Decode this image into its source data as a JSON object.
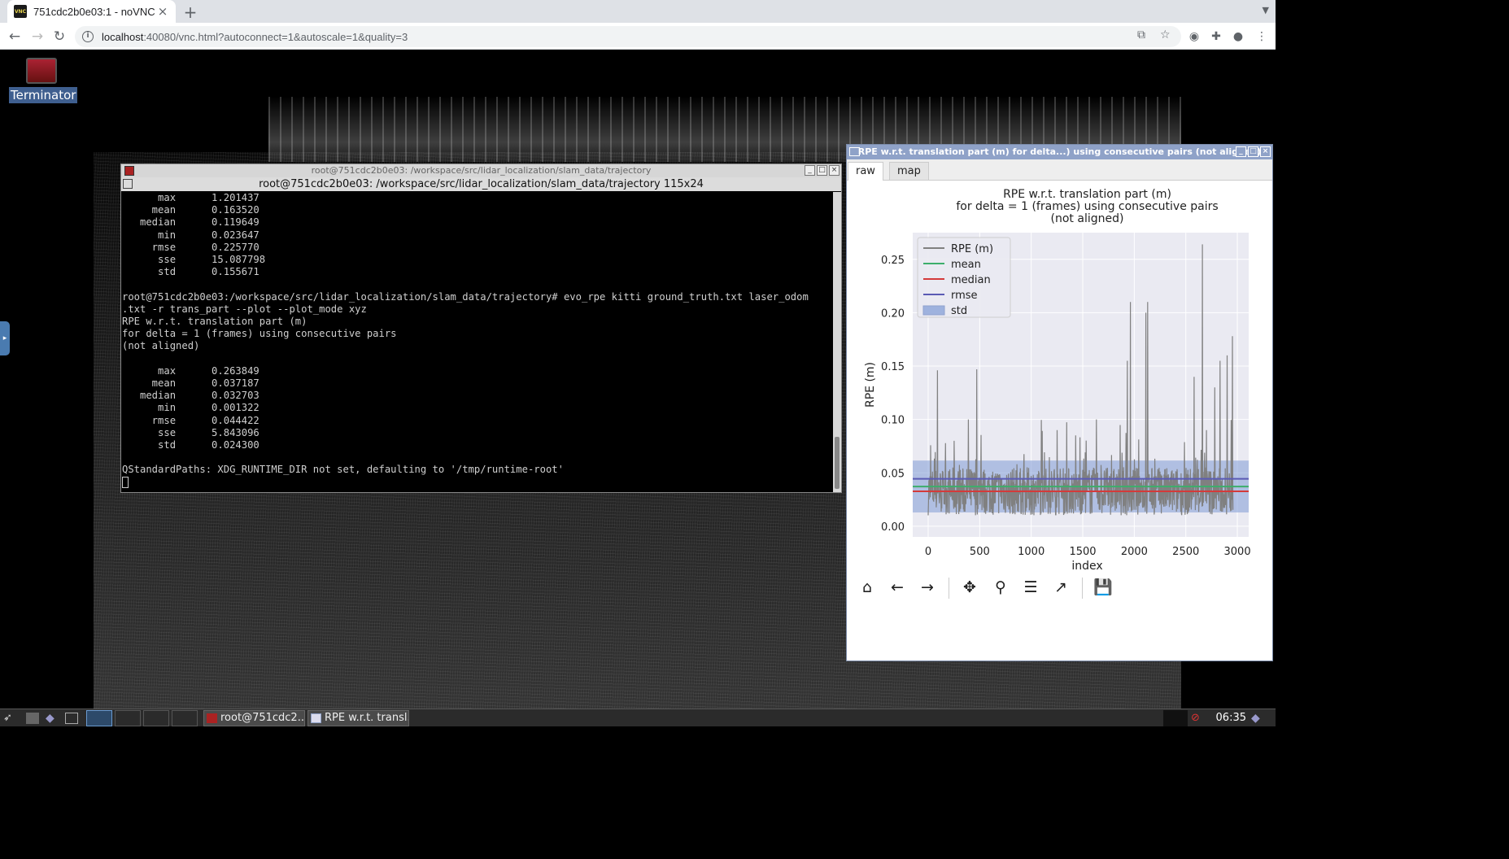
{
  "browser": {
    "tab_title": "751cdc2b0e03:1 - noVNC",
    "favicon_text": "VNC",
    "tab_close": "×",
    "new_tab": "+",
    "url_host": "localhost",
    "url_rest": ":40080/vnc.html?autoconnect=1&autoscale=1&quality=3"
  },
  "desktop": {
    "icon_label": "Terminator"
  },
  "terminal": {
    "window_title": "root@751cdc2b0e03: /workspace/src/lidar_localization/slam_data/trajectory",
    "header": "root@751cdc2b0e03: /workspace/src/lidar_localization/slam_data/trajectory 115x24",
    "lines": [
      "      max      1.201437",
      "     mean      0.163520",
      "   median      0.119649",
      "      min      0.023647",
      "     rmse      0.225770",
      "      sse      15.087798",
      "      std      0.155671",
      "",
      "root@751cdc2b0e03:/workspace/src/lidar_localization/slam_data/trajectory# evo_rpe kitti ground_truth.txt laser_odom",
      ".txt -r trans_part --plot --plot_mode xyz",
      "RPE w.r.t. translation part (m)",
      "for delta = 1 (frames) using consecutive pairs",
      "(not aligned)",
      "",
      "      max      0.263849",
      "     mean      0.037187",
      "   median      0.032703",
      "      min      0.001322",
      "     rmse      0.044422",
      "      sse      5.843096",
      "      std      0.024300",
      "",
      "QStandardPaths: XDG_RUNTIME_DIR not set, defaulting to '/tmp/runtime-root'"
    ]
  },
  "plot_window": {
    "title": "RPE w.r.t. translation part (m) for delta...) using consecutive pairs (not aligned)",
    "tabs": [
      "raw",
      "map"
    ]
  },
  "chart_data": {
    "type": "line",
    "title": "RPE w.r.t. translation part (m)",
    "subtitle_lines": [
      "for delta = 1 (frames) using consecutive pairs",
      "(not aligned)"
    ],
    "xlabel": "index",
    "ylabel": "RPE (m)",
    "xlim": [
      -150,
      3110
    ],
    "ylim": [
      -0.01,
      0.275
    ],
    "xticks": [
      0,
      500,
      1000,
      1500,
      2000,
      2500,
      3000
    ],
    "yticks": [
      0.0,
      0.05,
      0.1,
      0.15,
      0.2,
      0.25
    ],
    "ytick_labels": [
      "0.00",
      "0.05",
      "0.10",
      "0.15",
      "0.20",
      "0.25"
    ],
    "legend": [
      "RPE (m)",
      "mean",
      "median",
      "rmse",
      "std"
    ],
    "legend_location": "upper-left",
    "stats": {
      "max": 0.263849,
      "mean": 0.037187,
      "median": 0.032703,
      "min": 0.001322,
      "rmse": 0.044422,
      "std": 0.0243,
      "n": 2960
    },
    "peaks": [
      {
        "x": 90,
        "y": 0.146
      },
      {
        "x": 250,
        "y": 0.08
      },
      {
        "x": 470,
        "y": 0.147
      },
      {
        "x": 390,
        "y": 0.1
      },
      {
        "x": 1250,
        "y": 0.09
      },
      {
        "x": 1430,
        "y": 0.085
      },
      {
        "x": 1630,
        "y": 0.1
      },
      {
        "x": 1960,
        "y": 0.21
      },
      {
        "x": 1930,
        "y": 0.155
      },
      {
        "x": 2130,
        "y": 0.21
      },
      {
        "x": 2110,
        "y": 0.2
      },
      {
        "x": 2580,
        "y": 0.14
      },
      {
        "x": 2660,
        "y": 0.264
      },
      {
        "x": 2700,
        "y": 0.09
      },
      {
        "x": 2830,
        "y": 0.155
      },
      {
        "x": 2900,
        "y": 0.16
      },
      {
        "x": 2950,
        "y": 0.178
      },
      {
        "x": 2780,
        "y": 0.13
      }
    ],
    "colors": {
      "series": "#808080",
      "mean": "#3cae6b",
      "median": "#d43a3a",
      "rmse": "#5a5ab4",
      "std": "#7f9bd6",
      "background": "#eaeaf2"
    }
  },
  "plot_toolbar": {
    "icons": [
      "home-icon",
      "back-icon",
      "forward-icon",
      "pan-icon",
      "zoom-icon",
      "configure-icon",
      "edit-axis-icon",
      "save-icon"
    ],
    "glyphs": [
      "⌂",
      "←",
      "→",
      "✥",
      "⚲",
      "☰",
      "↗",
      "💾"
    ]
  },
  "taskbar": {
    "task1": "root@751cdc2...",
    "task2": "RPE w.r.t. transl...",
    "clock": "06:35"
  }
}
